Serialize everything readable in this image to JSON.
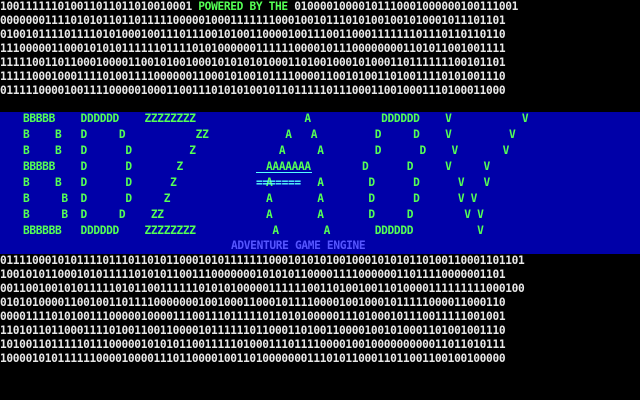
{
  "header": {
    "prefix_bits": "100111111010011011011010010001",
    "powered_by": "POWERED BY THE",
    "suffix_bits": "01000010000101110001000000100111001"
  },
  "binary_top": [
    "0000000111101010110110111110000010001111111000100101110101001001010001011101101",
    "0100101111011110101000100111011100101001100001001110011000111111101110110110110",
    "1110000011000101010111111011110101000000111111000010111000000001101011001001111",
    "1111100110110001000011001010010001010101010001101001000101000110111111100101101",
    "1111100010001111010011110000001100010100101111000011001010011010011110101001110",
    "0111110000100111100000100011001110101010010110111110111000110010001110100011000"
  ],
  "logo_lines": [
    "BBBBB    DDDDDD    ZZZZZZZZ                 A           DDDDDD    V           V",
    "B    B   D     D           ZZ            A   A         D     D    V         V",
    "B    B   D      D         Z             A     A        D      D    V       V",
    "BBBBB    D      D       Z             AAAAAAA        D      D     V     V",
    "B    B   D      D      Z              A       A       D      D      V   V",
    "B     B  D      D     Z               A       A       D      D      V V",
    "B     B  D     D    ZZ                A       A       D     D        V V",
    "BBBBBB   DDDDDD    ZZZZZZZZ            A       A       DDDDDD          V"
  ],
  "equals_line": "=======",
  "subtitle": "ADVENTURE GAME ENGINE",
  "binary_bottom": [
    "0111100010101111011101101011000101011111110001010101001000101010110100110001101101",
    "1001010110001010111110101011001110000000101010110000111100000011011110000001101",
    "0011001001010111110101100111111010101000001111110011010010011010000111111111000100",
    "0101010000110010011011110000000100100011000101111000010010001011111000011000110",
    "0000111101010011100000100001110011101111101101010000011101000101110011111001001",
    "1101011011000111101001100110000101111110110001101001100001001010001101001001110",
    "1010011011111011100000101010110011111010001110111100001001000000000011011010111",
    "1000010101111110000100001110110000100110100000001110101100011011001100100100000"
  ],
  "colors": {
    "background": "#000000",
    "band": "#0000a8",
    "binary_text": "#e8e8e8",
    "logo_green": "#55ff55",
    "logo_cyan": "#55ffff",
    "subtitle_blue": "#5555ff"
  }
}
